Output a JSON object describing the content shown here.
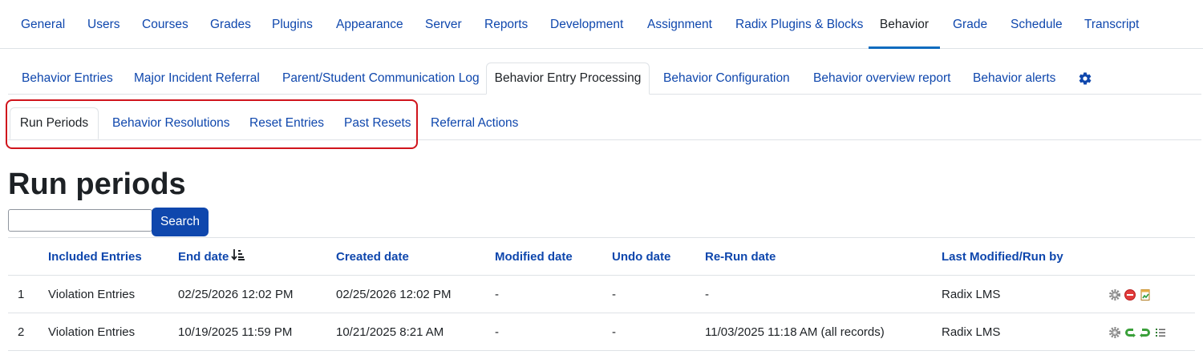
{
  "topnav": {
    "items": [
      "General",
      "Users",
      "Courses",
      "Grades",
      "Plugins",
      "Appearance",
      "Server",
      "Reports",
      "Development",
      "Assignment",
      "Radix Plugins & Blocks",
      "Behavior",
      "Grade",
      "Schedule",
      "Transcript"
    ],
    "active": "Behavior"
  },
  "secondary_tabs": {
    "items": [
      "Behavior Entries",
      "Major Incident Referral",
      "Parent/Student Communication Log",
      "Behavior Entry Processing",
      "Behavior Configuration",
      "Behavior overview report",
      "Behavior alerts"
    ],
    "active": "Behavior Entry Processing",
    "settings_icon": "gear-icon"
  },
  "tertiary_tabs": {
    "items": [
      "Run Periods",
      "Behavior Resolutions",
      "Reset Entries",
      "Past Resets",
      "Referral Actions"
    ],
    "active": "Run Periods"
  },
  "page_title": "Run periods",
  "search": {
    "value": "",
    "button_label": "Search"
  },
  "table": {
    "columns": [
      "Included Entries",
      "End date",
      "Created date",
      "Modified date",
      "Undo date",
      "Re-Run date",
      "Last Modified/Run by"
    ],
    "sorted_column": "End date",
    "rows": [
      {
        "num": "1",
        "included": "Violation Entries",
        "end_date": "02/25/2026 12:02 PM",
        "created_date": "02/25/2026 12:02 PM",
        "modified_date": "-",
        "undo_date": "-",
        "rerun_date": "-",
        "modified_by": "Radix LMS",
        "actions": [
          "gear-icon",
          "delete-icon",
          "report-icon"
        ]
      },
      {
        "num": "2",
        "included": "Violation Entries",
        "end_date": "10/19/2025 11:59 PM",
        "created_date": "10/21/2025 8:21 AM",
        "modified_date": "-",
        "undo_date": "-",
        "rerun_date": "11/03/2025 11:18 AM (all records)",
        "modified_by": "Radix LMS",
        "actions": [
          "gear-icon",
          "undo-icon",
          "redo-icon",
          "list-icon"
        ]
      }
    ]
  },
  "colors": {
    "link": "#0f47ad",
    "highlight_border": "#d0141c",
    "primary_button": "#0f47ad"
  }
}
